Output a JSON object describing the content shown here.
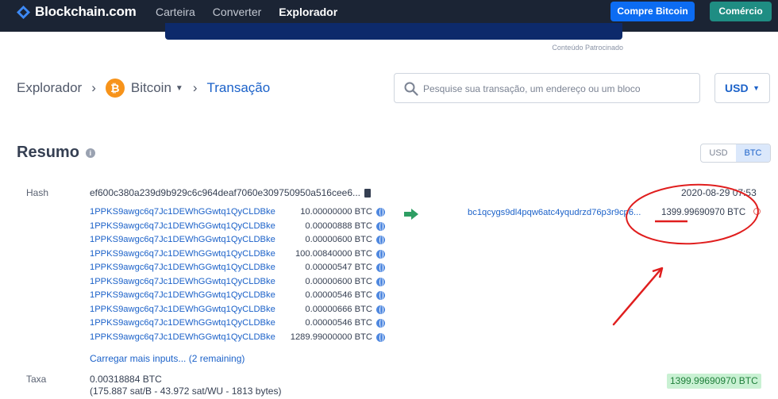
{
  "nav": {
    "brand": "Blockchain.com",
    "links": [
      {
        "label": "Carteira"
      },
      {
        "label": "Converter"
      },
      {
        "label": "Explorador"
      }
    ],
    "buy_button": "Compre Bitcoin",
    "trade_button": "Comércio"
  },
  "banner": {
    "sponsored_label": "Conteúdo Patrocinado"
  },
  "breadcrumb": {
    "root": "Explorador",
    "coin": "Bitcoin",
    "coin_symbol": "₿",
    "current": "Transação"
  },
  "search": {
    "placeholder": "Pesquise sua transação, um endereço ou um bloco"
  },
  "currency_selector": "USD",
  "summary": {
    "title": "Resumo",
    "toggle": [
      "USD",
      "BTC"
    ],
    "toggle_selected": "BTC"
  },
  "transaction": {
    "hash_label": "Hash",
    "hash": "ef600c380a239d9b929c6c964deaf7060e309750950a516cee6...",
    "date": "2020-08-29 07:53",
    "inputs": [
      {
        "address": "1PPKS9awgc6q7Jc1DEWhGGwtq1QyCLDBke",
        "amount": "10.00000000 BTC"
      },
      {
        "address": "1PPKS9awgc6q7Jc1DEWhGGwtq1QyCLDBke",
        "amount": "0.00000888 BTC"
      },
      {
        "address": "1PPKS9awgc6q7Jc1DEWhGGwtq1QyCLDBke",
        "amount": "0.00000600 BTC"
      },
      {
        "address": "1PPKS9awgc6q7Jc1DEWhGGwtq1QyCLDBke",
        "amount": "100.00840000 BTC"
      },
      {
        "address": "1PPKS9awgc6q7Jc1DEWhGGwtq1QyCLDBke",
        "amount": "0.00000547 BTC"
      },
      {
        "address": "1PPKS9awgc6q7Jc1DEWhGGwtq1QyCLDBke",
        "amount": "0.00000600 BTC"
      },
      {
        "address": "1PPKS9awgc6q7Jc1DEWhGGwtq1QyCLDBke",
        "amount": "0.00000546 BTC"
      },
      {
        "address": "1PPKS9awgc6q7Jc1DEWhGGwtq1QyCLDBke",
        "amount": "0.00000666 BTC"
      },
      {
        "address": "1PPKS9awgc6q7Jc1DEWhGGwtq1QyCLDBke",
        "amount": "0.00000546 BTC"
      },
      {
        "address": "1PPKS9awgc6q7Jc1DEWhGGwtq1QyCLDBke",
        "amount": "1289.99000000 BTC"
      }
    ],
    "load_more": "Carregar mais inputs... (2 remaining)",
    "output": {
      "address": "bc1qcygs9dl4pqw6atc4yqudrzd76p3r9cp6...",
      "amount": "1399.99690970 BTC"
    },
    "fee_label": "Taxa",
    "fee": "0.00318884 BTC",
    "fee_detail": "(175.887 sat/B - 43.972 sat/WU - 1813 bytes)",
    "total": "1399.99690970 BTC"
  },
  "colors": {
    "nav_bg": "#1b2434",
    "link_blue": "#1c62c9",
    "buy_button": "#0c6cf2",
    "trade_button": "#1f8d83",
    "bitcoin_orange": "#f7931a",
    "annotation_red": "#e01e1e",
    "total_badge_bg": "#c9f1d3"
  }
}
